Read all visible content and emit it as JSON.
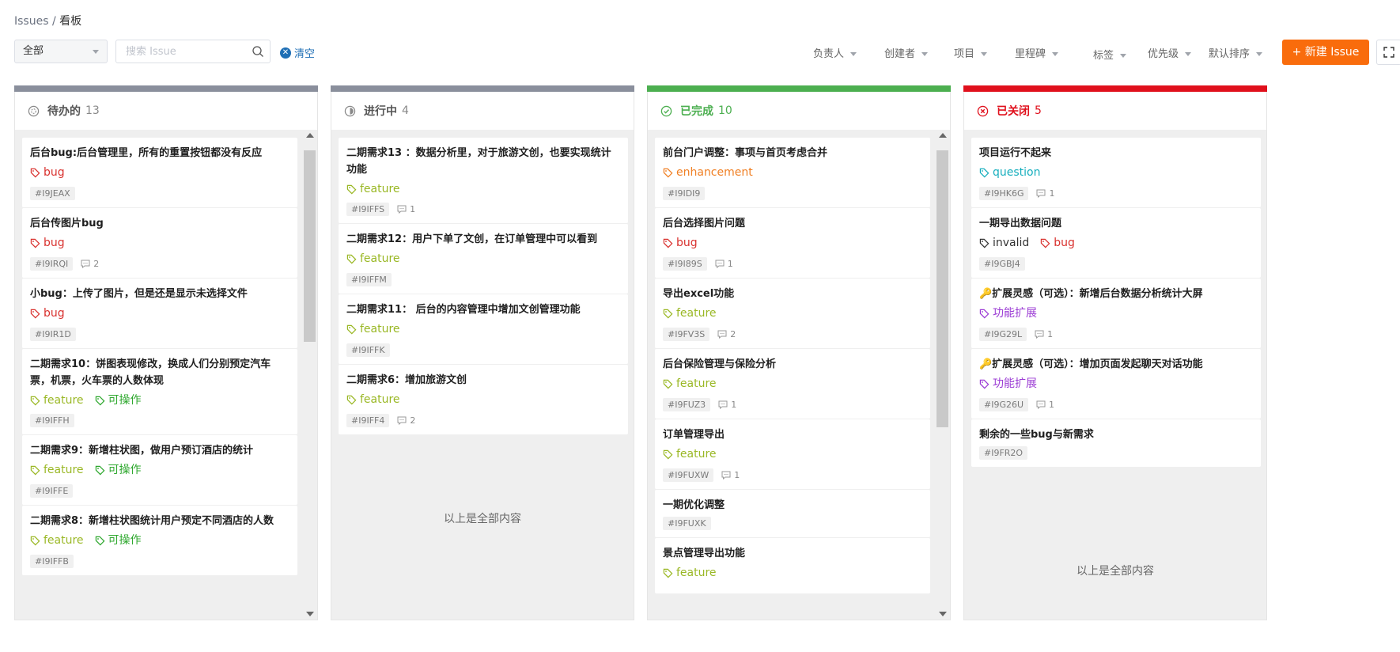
{
  "breadcrumb": {
    "root": "Issues",
    "sep": " / ",
    "current": "看板"
  },
  "toolbar": {
    "scope": "全部",
    "search_placeholder": "搜索 Issue",
    "clear_label": "清空",
    "filters": [
      "负责人",
      "创建者",
      "项目",
      "里程碑",
      "标签",
      "优先级",
      "默认排序"
    ],
    "new_issue_label": "+ 新建 Issue"
  },
  "end_note": "以上是全部内容",
  "colors": {
    "todo": "#8a8f9c",
    "doing": "#8a8f9c",
    "done": "#4caf50",
    "closed": "#e0101c",
    "bug": "#d9322f",
    "feature": "#9ab825",
    "enhancement": "#f07f23",
    "question": "#16aebd",
    "operable": "#2fa82f",
    "extension": "#9b3bd4",
    "invalid": "#333333",
    "primary": "#f96c0c"
  },
  "columns": [
    {
      "name": "待办的",
      "count": "13",
      "cards": [
        {
          "title": "后台bug:后台管理里，所有的重置按钮都没有反应",
          "labels": [
            {
              "text": "bug",
              "color": "bug"
            }
          ],
          "id": "#I9JEAX",
          "comments": ""
        },
        {
          "title": "后台传图片bug",
          "labels": [
            {
              "text": "bug",
              "color": "bug"
            }
          ],
          "id": "#I9IRQI",
          "comments": "2"
        },
        {
          "title": "小bug：上传了图片，但是还是显示未选择文件",
          "labels": [
            {
              "text": "bug",
              "color": "bug"
            }
          ],
          "id": "#I9IR1D",
          "comments": ""
        },
        {
          "title": "二期需求10：饼图表现修改，换成人们分别预定汽车票，机票，火车票的人数体现",
          "labels": [
            {
              "text": "feature",
              "color": "feature"
            },
            {
              "text": "可操作",
              "color": "operable"
            }
          ],
          "id": "#I9IFFH",
          "comments": ""
        },
        {
          "title": "二期需求9：新增柱状图，做用户预订酒店的统计",
          "labels": [
            {
              "text": "feature",
              "color": "feature"
            },
            {
              "text": "可操作",
              "color": "operable"
            }
          ],
          "id": "#I9IFFE",
          "comments": ""
        },
        {
          "title": "二期需求8：新增柱状图统计用户预定不同酒店的人数",
          "labels": [
            {
              "text": "feature",
              "color": "feature"
            },
            {
              "text": "可操作",
              "color": "operable"
            }
          ],
          "id": "#I9IFFB",
          "comments": ""
        }
      ]
    },
    {
      "name": "进行中",
      "count": "4",
      "cards": [
        {
          "title": "二期需求13 ：数据分析里，对于旅游文创，也要实现统计功能",
          "labels": [
            {
              "text": "feature",
              "color": "feature"
            }
          ],
          "id": "#I9IFFS",
          "comments": "1"
        },
        {
          "title": "二期需求12：用户下单了文创，在订单管理中可以看到",
          "labels": [
            {
              "text": "feature",
              "color": "feature"
            }
          ],
          "id": "#I9IFFM",
          "comments": ""
        },
        {
          "title": "二期需求11： 后台的内容管理中增加文创管理功能",
          "labels": [
            {
              "text": "feature",
              "color": "feature"
            }
          ],
          "id": "#I9IFFK",
          "comments": ""
        },
        {
          "title": "二期需求6：增加旅游文创",
          "labels": [
            {
              "text": "feature",
              "color": "feature"
            }
          ],
          "id": "#I9IFF4",
          "comments": "2"
        }
      ]
    },
    {
      "name": "已完成",
      "count": "10",
      "cards": [
        {
          "title": "前台门户调整：事项与首页考虑合并",
          "labels": [
            {
              "text": "enhancement",
              "color": "enhancement"
            }
          ],
          "id": "#I9IDI9",
          "comments": ""
        },
        {
          "title": "后台选择图片问题",
          "labels": [
            {
              "text": "bug",
              "color": "bug"
            }
          ],
          "id": "#I9I89S",
          "comments": "1"
        },
        {
          "title": "导出excel功能",
          "labels": [
            {
              "text": "feature",
              "color": "feature"
            }
          ],
          "id": "#I9FV3S",
          "comments": "2"
        },
        {
          "title": "后台保险管理与保险分析",
          "labels": [
            {
              "text": "feature",
              "color": "feature"
            }
          ],
          "id": "#I9FUZ3",
          "comments": "1"
        },
        {
          "title": "订单管理导出",
          "labels": [
            {
              "text": "feature",
              "color": "feature"
            }
          ],
          "id": "#I9FUXW",
          "comments": "1"
        },
        {
          "title": "一期优化调整",
          "labels": [],
          "id": "#I9FUXK",
          "comments": ""
        },
        {
          "title": "景点管理导出功能",
          "labels": [
            {
              "text": "feature",
              "color": "feature"
            }
          ],
          "id": "",
          "comments": ""
        }
      ]
    },
    {
      "name": "已关闭",
      "count": "5",
      "cards": [
        {
          "title": "项目运行不起来",
          "labels": [
            {
              "text": "question",
              "color": "question"
            }
          ],
          "id": "#I9HK6G",
          "comments": "1"
        },
        {
          "title": "一期导出数据问题",
          "labels": [
            {
              "text": "invalid",
              "color": "invalid"
            },
            {
              "text": "bug",
              "color": "bug"
            }
          ],
          "id": "#I9GBJ4",
          "comments": ""
        },
        {
          "title": "🔑扩展灵感（可选）：新增后台数据分析统计大屏",
          "labels": [
            {
              "text": "功能扩展",
              "color": "extension"
            }
          ],
          "id": "#I9G29L",
          "comments": "1"
        },
        {
          "title": "🔑扩展灵感（可选）：增加页面发起聊天对话功能",
          "labels": [
            {
              "text": "功能扩展",
              "color": "extension"
            }
          ],
          "id": "#I9G26U",
          "comments": "1"
        },
        {
          "title": "剩余的一些bug与新需求",
          "labels": [],
          "id": "#I9FR2O",
          "comments": ""
        }
      ]
    }
  ]
}
